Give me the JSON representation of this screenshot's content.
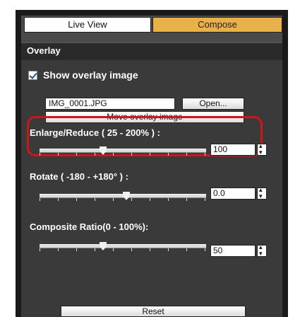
{
  "tabs": {
    "live_view": "Live View",
    "compose": "Compose"
  },
  "overlay": {
    "section_title": "Overlay",
    "show_overlay_label": "Show overlay image",
    "show_overlay_checked": true,
    "file_name": "IMG_0001.JPG",
    "open_label": "Open...",
    "move_label": "Move overlay image"
  },
  "enlarge": {
    "label": "Enlarge/Reduce ( 25 - 200% ) :",
    "value": "100"
  },
  "rotate": {
    "label": "Rotate ( -180 - +180° ) :",
    "value": "0.0"
  },
  "ratio": {
    "label": "Composite Ratio(0 - 100%):",
    "value": "50"
  },
  "reset_label": "Reset",
  "colors": {
    "accent_tab": "#e8b24a",
    "highlight": "#d0141a",
    "panel_bg": "#3a3a3a"
  }
}
